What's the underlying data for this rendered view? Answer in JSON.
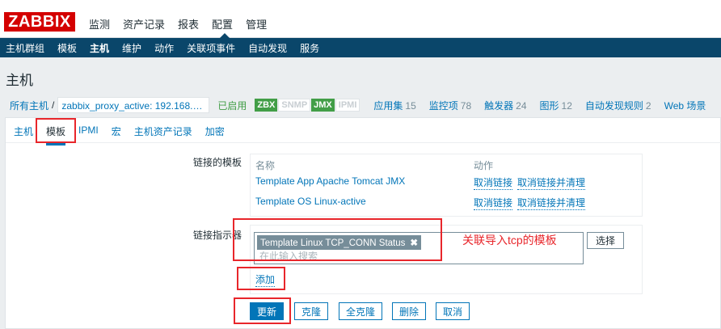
{
  "logo": "ZABBIX",
  "main_menu": [
    "监测",
    "资产记录",
    "报表",
    "配置",
    "管理"
  ],
  "sub_menu": [
    "主机群组",
    "模板",
    "主机",
    "维护",
    "动作",
    "关联项事件",
    "自动发现",
    "服务"
  ],
  "page_title": "主机",
  "breadcrumb": {
    "all_hosts": "所有主机",
    "separator": "/",
    "host": "zabbix_proxy_active: 192.168.…",
    "status": "已启用",
    "availability": [
      "ZBX",
      "SNMP",
      "JMX",
      "IPMI"
    ],
    "stats": [
      {
        "label": "应用集",
        "count": "15"
      },
      {
        "label": "监控项",
        "count": "78"
      },
      {
        "label": "触发器",
        "count": "24"
      },
      {
        "label": "图形",
        "count": "12"
      },
      {
        "label": "自动发现规则",
        "count": "2"
      },
      {
        "label": "Web 场景",
        "count": ""
      }
    ]
  },
  "tabs": [
    "主机",
    "模板",
    "IPMI",
    "宏",
    "主机资产记录",
    "加密"
  ],
  "form": {
    "linked_label": "链接的模板",
    "col_name": "名称",
    "col_action": "动作",
    "templates": [
      {
        "name": "Template App Apache Tomcat JMX",
        "unlink": "取消链接",
        "unlink_clear": "取消链接并清理"
      },
      {
        "name": "Template OS Linux-active",
        "unlink": "取消链接",
        "unlink_clear": "取消链接并清理"
      }
    ],
    "link_label": "链接指示器",
    "selected_chip": "Template Linux TCP_CONN Status",
    "chip_remove": "✖",
    "search_placeholder": "在此输入搜索",
    "select_button": "选择",
    "add_link": "添加"
  },
  "annotation": "关联导入tcp的模板",
  "buttons": [
    "更新",
    "克隆",
    "全克隆",
    "删除",
    "取消"
  ],
  "colors": {
    "accent": "#0275b8",
    "nav": "#0a466a",
    "brand": "#d40000",
    "enabled": "#429e47",
    "highlight": "#e8262b"
  }
}
